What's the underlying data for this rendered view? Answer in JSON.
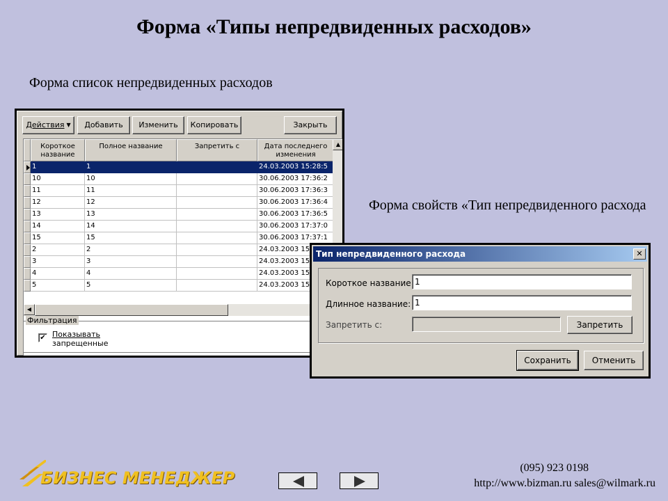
{
  "slide": {
    "title": "Форма «Типы непредвиденных расходов»",
    "caption_list": "Форма список непредвиденных расходов",
    "caption_props": "Форма свойств «Тип непредвиденного расхода"
  },
  "list_window": {
    "toolbar": {
      "actions": "Действия",
      "add": "Добавить",
      "edit": "Изменить",
      "copy": "Копировать",
      "close": "Закрыть"
    },
    "columns": [
      "Короткое название",
      "Полное название",
      "Запретить с",
      "Дата последнего изменения"
    ],
    "rows": [
      {
        "short": "1",
        "full": "1",
        "forbid": "",
        "date": "24.03.2003 15:28:5",
        "selected": true
      },
      {
        "short": "10",
        "full": "10",
        "forbid": "",
        "date": "30.06.2003 17:36:2"
      },
      {
        "short": "11",
        "full": "11",
        "forbid": "",
        "date": "30.06.2003 17:36:3"
      },
      {
        "short": "12",
        "full": "12",
        "forbid": "",
        "date": "30.06.2003 17:36:4"
      },
      {
        "short": "13",
        "full": "13",
        "forbid": "",
        "date": "30.06.2003 17:36:5"
      },
      {
        "short": "14",
        "full": "14",
        "forbid": "",
        "date": "30.06.2003 17:37:0"
      },
      {
        "short": "15",
        "full": "15",
        "forbid": "",
        "date": "30.06.2003 17:37:1"
      },
      {
        "short": "2",
        "full": "2",
        "forbid": "",
        "date": "24.03.2003 15:"
      },
      {
        "short": "3",
        "full": "3",
        "forbid": "",
        "date": "24.03.2003 15:"
      },
      {
        "short": "4",
        "full": "4",
        "forbid": "",
        "date": "24.03.2003 15:"
      },
      {
        "short": "5",
        "full": "5",
        "forbid": "",
        "date": "24.03.2003 15:"
      }
    ],
    "filter": {
      "legend": "Фильтрация",
      "show_forbidden_label_1": "Показывать",
      "show_forbidden_label_2": "запрещенные",
      "show_forbidden_checked": true
    }
  },
  "dialog": {
    "title": "Тип непредвиденного расхода",
    "short_name_label": "Короткое название:",
    "short_name_value": "1",
    "long_name_label": "Длинное название:",
    "long_name_value": "1",
    "forbid_label": "Запретить с:",
    "forbid_value": "",
    "forbid_button": "Запретить",
    "save_button": "Сохранить",
    "cancel_button": "Отменить"
  },
  "footer": {
    "logo_text": "БИЗНЕС МЕНЕДЖЕР",
    "phone": "(095) 923 0198",
    "web_email": "http://www.bizman.ru  sales@wilmark.ru",
    "prev_icon": "triangle-left-icon",
    "next_icon": "triangle-right-icon"
  }
}
